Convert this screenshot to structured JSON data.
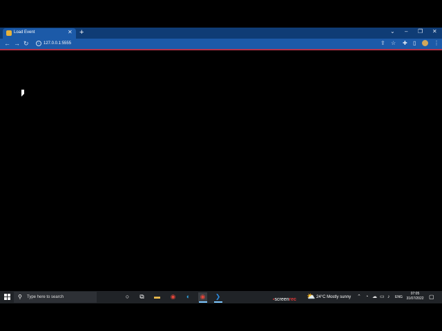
{
  "browser": {
    "tab_title": "Load Event",
    "url": "127.0.0.1:5555",
    "icons": {
      "tab_close": "✕",
      "new_tab": "+",
      "tab_list": "⌄",
      "minimize": "–",
      "restore": "❐",
      "close": "✕",
      "back": "←",
      "forward": "→",
      "reload": "↻",
      "info": "i",
      "share": "⇪",
      "bookmark": "☆",
      "extensions": "✚",
      "sidepanel": "▯",
      "menu": "⋮"
    }
  },
  "taskbar": {
    "search_placeholder": "Type here to search",
    "search_glyph": "⚲",
    "weather": "24°C  Mostly sunny",
    "weather_glyph": "⛅",
    "lang": "ENG",
    "time": "07:05",
    "date": "31/07/2022",
    "screenrec_prefix": "screen",
    "screenrec_suffix": "rec",
    "icons": {
      "cortana": "○",
      "task_view": "⧉",
      "chrome": "◉",
      "edge": "◐",
      "chrome2": "◉",
      "vscode": "❯",
      "files": "▬",
      "tray_up": "⌃",
      "tray_a": "◔",
      "tray_b": "☁",
      "tray_c": "▭",
      "tray_d": "♪",
      "notification": "▢"
    }
  },
  "colors": {
    "tabstrip": "#0f3c75",
    "toolbar": "#1c5aa8",
    "accent": "#b5334a",
    "taskbar": "#202327"
  }
}
